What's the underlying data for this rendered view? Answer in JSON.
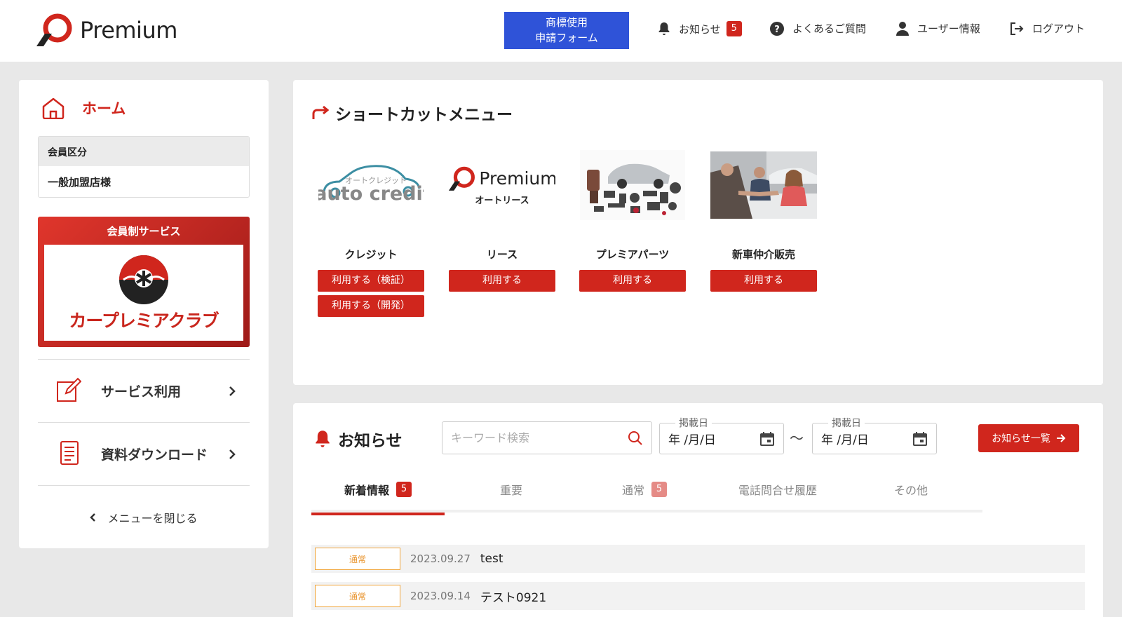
{
  "header": {
    "logo_text": "Premium",
    "trademark_button": [
      "商標使用",
      "申請フォーム"
    ],
    "nav": {
      "notice_label": "お知らせ",
      "notice_count": "5",
      "faq_label": "よくあるご質問",
      "user_label": "ユーザー情報",
      "logout_label": "ログアウト"
    }
  },
  "sidebar": {
    "home_label": "ホーム",
    "member_heading": "会員区分",
    "member_value": "一般加盟店様",
    "club_heading": "会員制サービス",
    "club_name": "カープレミアクラブ",
    "links": [
      {
        "label": "サービス利用",
        "icon": "edit-icon"
      },
      {
        "label": "資料ダウンロード",
        "icon": "document-icon"
      }
    ],
    "close_label": "メニューを閉じる"
  },
  "shortcut": {
    "title": "ショートカットメニュー",
    "items": [
      {
        "name": "クレジット",
        "logo": "auto credit",
        "logo_kana": "オートクレジット",
        "buttons": [
          "利用する（検証）",
          "利用する（開発）"
        ]
      },
      {
        "name": "リース",
        "logo": "Premium",
        "logo_sub": "オートリース",
        "buttons": [
          "利用する"
        ]
      },
      {
        "name": "プレミアパーツ",
        "buttons": [
          "利用する"
        ]
      },
      {
        "name": "新車仲介販売",
        "buttons": [
          "利用する"
        ]
      }
    ]
  },
  "news": {
    "title": "お知らせ",
    "search_placeholder": "キーワード検索",
    "date_label": "掲載日",
    "date_value": "年 /月/日",
    "tilde": "〜",
    "all_button": "お知らせ一覧",
    "tabs": [
      {
        "label": "新着情報",
        "count": "5",
        "active": true
      },
      {
        "label": "重要"
      },
      {
        "label": "通常",
        "count": "5"
      },
      {
        "label": "電話問合せ履歴"
      },
      {
        "label": "その他"
      }
    ],
    "rows": [
      {
        "category": "通常",
        "date": "2023.09.27",
        "title": "test"
      },
      {
        "category": "通常",
        "date": "2023.09.14",
        "title": "テスト0921"
      }
    ]
  },
  "colors": {
    "accent": "#d0261d",
    "blue_button": "#2f53d8",
    "category_border": "#f0a53a"
  }
}
